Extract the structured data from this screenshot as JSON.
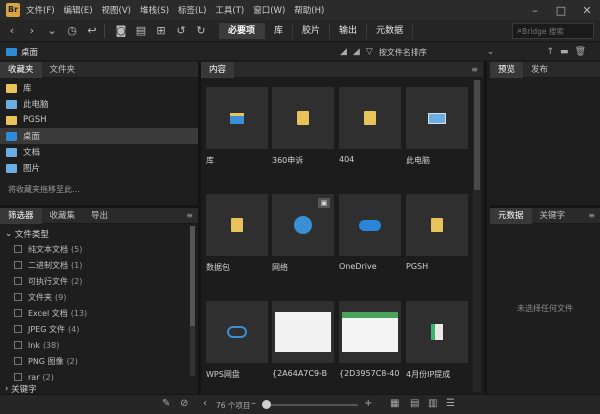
{
  "app": {
    "logo": "Br"
  },
  "menu": [
    "文件(F)",
    "编辑(E)",
    "视图(V)",
    "堆栈(S)",
    "标签(L)",
    "工具(T)",
    "窗口(W)",
    "帮助(H)"
  ],
  "workspaces": [
    "必要项",
    "库",
    "胶片",
    "输出",
    "元数据"
  ],
  "search": {
    "placeholder": "Bridge 搜索"
  },
  "path": {
    "current": "桌面"
  },
  "sort": {
    "label": "按文件名排序"
  },
  "favorites": {
    "tabs": [
      "收藏夹",
      "文件夹"
    ],
    "items": [
      {
        "label": "库",
        "color": "#e8c35a"
      },
      {
        "label": "此电脑",
        "color": "#6aaee6"
      },
      {
        "label": "PGSH",
        "color": "#e8c35a"
      },
      {
        "label": "桌面",
        "color": "#2f8ad8"
      },
      {
        "label": "文档",
        "color": "#6aaee6"
      },
      {
        "label": "图片",
        "color": "#6aaee6"
      }
    ],
    "hint": "将收藏夹拖移至此..."
  },
  "filter": {
    "tabs": [
      "筛选器",
      "收藏集",
      "导出"
    ],
    "group": "文件类型",
    "items": [
      {
        "label": "纯文本文档",
        "count": "(5)"
      },
      {
        "label": "二进制文档",
        "count": "(1)"
      },
      {
        "label": "可执行文件",
        "count": "(2)"
      },
      {
        "label": "文件夹",
        "count": "(9)"
      },
      {
        "label": "Excel 文档",
        "count": "(13)"
      },
      {
        "label": "JPEG 文件",
        "count": "(4)"
      },
      {
        "label": "lnk",
        "count": "(38)"
      },
      {
        "label": "PNG 图像",
        "count": "(2)"
      },
      {
        "label": "rar",
        "count": "(2)"
      }
    ],
    "keyword_group": "关键字"
  },
  "content": {
    "tab": "内容",
    "thumbs": [
      {
        "label": "库",
        "icon": "library-icon"
      },
      {
        "label": "360申诉",
        "icon": "folder-icon"
      },
      {
        "label": "404",
        "icon": "folder-icon"
      },
      {
        "label": "此电脑",
        "icon": "computer-icon"
      },
      {
        "label": "数据包",
        "icon": "folder-icon"
      },
      {
        "label": "网络",
        "icon": "network-icon"
      },
      {
        "label": "OneDrive",
        "icon": "onedrive-icon"
      },
      {
        "label": "PGSH",
        "icon": "folder-icon"
      },
      {
        "label": "WPS网盘",
        "icon": "wps-cloud-icon"
      },
      {
        "label": "{2A64A7C9-B",
        "icon": "screenshot-icon"
      },
      {
        "label": "{2D3957C8-40",
        "icon": "screenshot-icon"
      },
      {
        "label": "4月份IP提成",
        "icon": "spreadsheet-icon"
      }
    ]
  },
  "preview": {
    "tabs": [
      "预览",
      "发布"
    ]
  },
  "metadata": {
    "tabs": [
      "元数据",
      "关键字"
    ],
    "empty": "未选择任何文件"
  },
  "status": {
    "count": "76 个项目"
  }
}
